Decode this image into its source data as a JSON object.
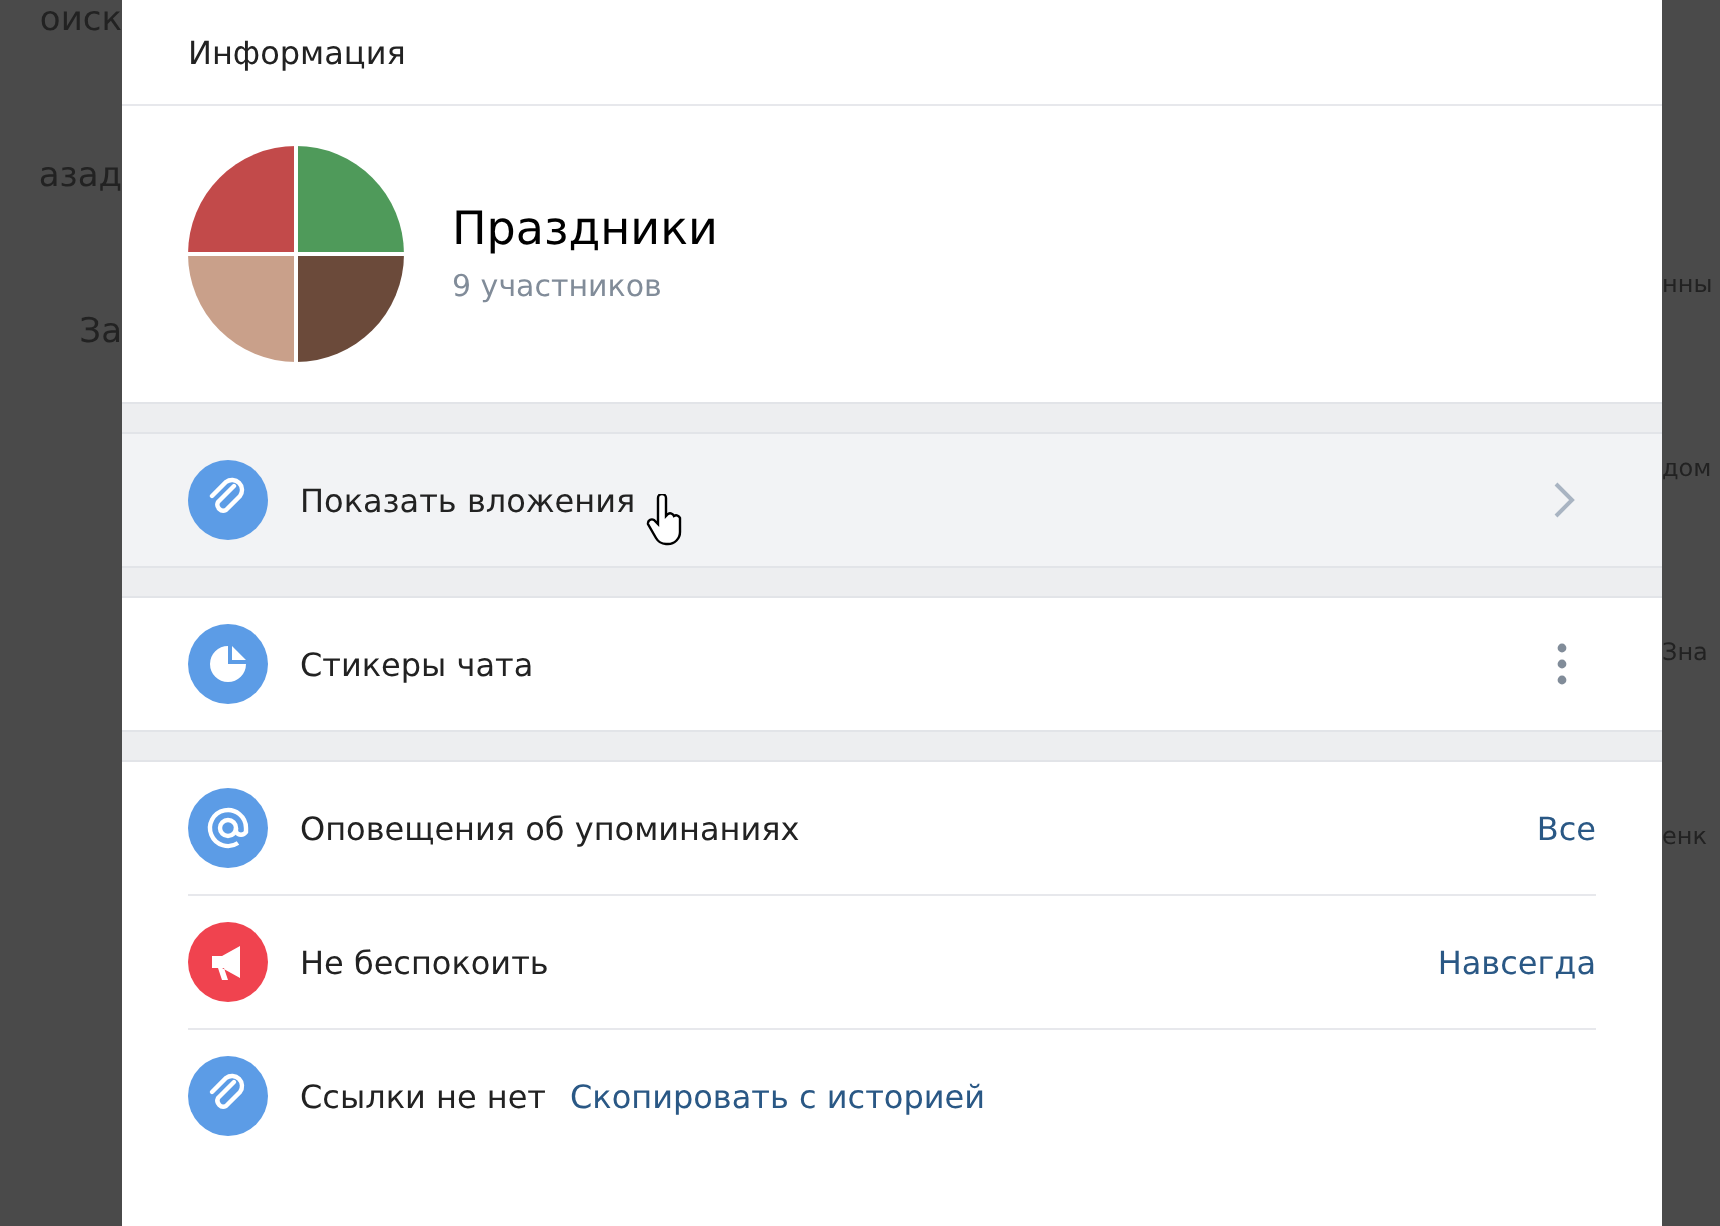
{
  "background": {
    "left_texts": [
      "оиск",
      "азад",
      "За"
    ],
    "right_texts": [
      "нны",
      "дом",
      "Зна",
      "енк"
    ]
  },
  "dialog": {
    "title": "Информация",
    "chat": {
      "name": "Праздники",
      "members": "9 участников"
    },
    "sections": [
      {
        "rows": [
          {
            "kind": "attachments",
            "label": "Показать вложения",
            "color": "#5c9ce6",
            "hovered": true
          }
        ]
      },
      {
        "rows": [
          {
            "kind": "stickers",
            "label": "Стикеры чата",
            "color": "#5c9ce6",
            "hovered": false
          }
        ]
      },
      {
        "rows": [
          {
            "kind": "mentions",
            "label": "Оповещения об упоминаниях",
            "value": "Все",
            "color": "#5c9ce6",
            "hovered": false
          },
          {
            "kind": "mute",
            "label": "Не беспокоить",
            "value": "Навсегда",
            "color": "#f0434f",
            "hovered": false
          },
          {
            "kind": "link",
            "label": "Ссылки не нет",
            "link": "Скопировать с историей",
            "color": "#5c9ce6",
            "hovered": false
          }
        ]
      }
    ]
  }
}
